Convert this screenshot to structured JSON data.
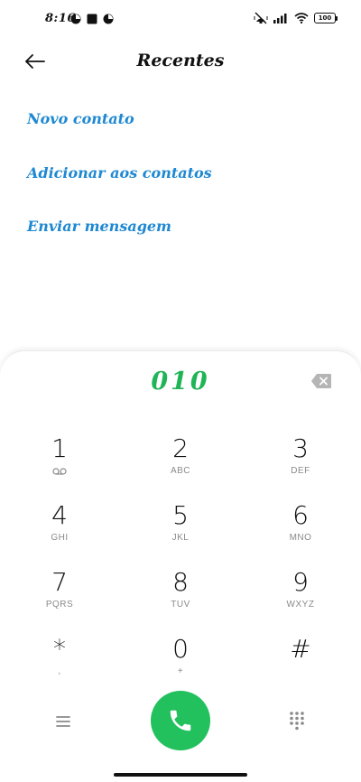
{
  "status_bar": {
    "time": "8:16",
    "battery": "100"
  },
  "header": {
    "title": "Recentes"
  },
  "actions": {
    "new_contact": "Novo contato",
    "add_to_contacts": "Adicionar aos contatos",
    "send_message": "Enviar mensagem"
  },
  "dialer": {
    "number": "010",
    "keys": [
      {
        "digit": "1",
        "letters": ""
      },
      {
        "digit": "2",
        "letters": "ABC"
      },
      {
        "digit": "3",
        "letters": "DEF"
      },
      {
        "digit": "4",
        "letters": "GHI"
      },
      {
        "digit": "5",
        "letters": "JKL"
      },
      {
        "digit": "6",
        "letters": "MNO"
      },
      {
        "digit": "7",
        "letters": "PQRS"
      },
      {
        "digit": "8",
        "letters": "TUV"
      },
      {
        "digit": "9",
        "letters": "WXYZ"
      },
      {
        "digit": "*",
        "letters": ","
      },
      {
        "digit": "0",
        "letters": "+"
      },
      {
        "digit": "#",
        "letters": ""
      }
    ]
  },
  "colors": {
    "accent_link": "#1e88d2",
    "dialed_number": "#1fb456",
    "call_button": "#22c15e"
  }
}
